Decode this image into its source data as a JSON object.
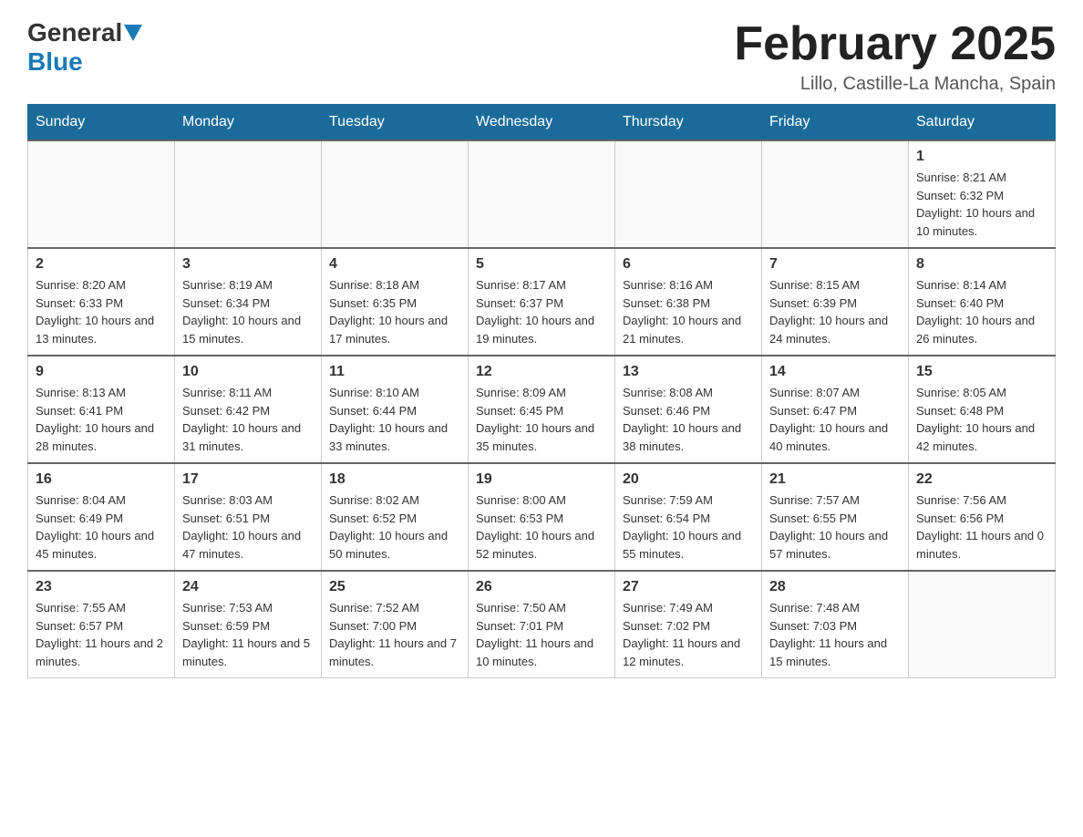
{
  "header": {
    "logo_general": "General",
    "logo_blue": "Blue",
    "month_title": "February 2025",
    "location": "Lillo, Castille-La Mancha, Spain"
  },
  "days_of_week": [
    "Sunday",
    "Monday",
    "Tuesday",
    "Wednesday",
    "Thursday",
    "Friday",
    "Saturday"
  ],
  "weeks": [
    [
      {
        "day": "",
        "info": ""
      },
      {
        "day": "",
        "info": ""
      },
      {
        "day": "",
        "info": ""
      },
      {
        "day": "",
        "info": ""
      },
      {
        "day": "",
        "info": ""
      },
      {
        "day": "",
        "info": ""
      },
      {
        "day": "1",
        "info": "Sunrise: 8:21 AM\nSunset: 6:32 PM\nDaylight: 10 hours and 10 minutes."
      }
    ],
    [
      {
        "day": "2",
        "info": "Sunrise: 8:20 AM\nSunset: 6:33 PM\nDaylight: 10 hours and 13 minutes."
      },
      {
        "day": "3",
        "info": "Sunrise: 8:19 AM\nSunset: 6:34 PM\nDaylight: 10 hours and 15 minutes."
      },
      {
        "day": "4",
        "info": "Sunrise: 8:18 AM\nSunset: 6:35 PM\nDaylight: 10 hours and 17 minutes."
      },
      {
        "day": "5",
        "info": "Sunrise: 8:17 AM\nSunset: 6:37 PM\nDaylight: 10 hours and 19 minutes."
      },
      {
        "day": "6",
        "info": "Sunrise: 8:16 AM\nSunset: 6:38 PM\nDaylight: 10 hours and 21 minutes."
      },
      {
        "day": "7",
        "info": "Sunrise: 8:15 AM\nSunset: 6:39 PM\nDaylight: 10 hours and 24 minutes."
      },
      {
        "day": "8",
        "info": "Sunrise: 8:14 AM\nSunset: 6:40 PM\nDaylight: 10 hours and 26 minutes."
      }
    ],
    [
      {
        "day": "9",
        "info": "Sunrise: 8:13 AM\nSunset: 6:41 PM\nDaylight: 10 hours and 28 minutes."
      },
      {
        "day": "10",
        "info": "Sunrise: 8:11 AM\nSunset: 6:42 PM\nDaylight: 10 hours and 31 minutes."
      },
      {
        "day": "11",
        "info": "Sunrise: 8:10 AM\nSunset: 6:44 PM\nDaylight: 10 hours and 33 minutes."
      },
      {
        "day": "12",
        "info": "Sunrise: 8:09 AM\nSunset: 6:45 PM\nDaylight: 10 hours and 35 minutes."
      },
      {
        "day": "13",
        "info": "Sunrise: 8:08 AM\nSunset: 6:46 PM\nDaylight: 10 hours and 38 minutes."
      },
      {
        "day": "14",
        "info": "Sunrise: 8:07 AM\nSunset: 6:47 PM\nDaylight: 10 hours and 40 minutes."
      },
      {
        "day": "15",
        "info": "Sunrise: 8:05 AM\nSunset: 6:48 PM\nDaylight: 10 hours and 42 minutes."
      }
    ],
    [
      {
        "day": "16",
        "info": "Sunrise: 8:04 AM\nSunset: 6:49 PM\nDaylight: 10 hours and 45 minutes."
      },
      {
        "day": "17",
        "info": "Sunrise: 8:03 AM\nSunset: 6:51 PM\nDaylight: 10 hours and 47 minutes."
      },
      {
        "day": "18",
        "info": "Sunrise: 8:02 AM\nSunset: 6:52 PM\nDaylight: 10 hours and 50 minutes."
      },
      {
        "day": "19",
        "info": "Sunrise: 8:00 AM\nSunset: 6:53 PM\nDaylight: 10 hours and 52 minutes."
      },
      {
        "day": "20",
        "info": "Sunrise: 7:59 AM\nSunset: 6:54 PM\nDaylight: 10 hours and 55 minutes."
      },
      {
        "day": "21",
        "info": "Sunrise: 7:57 AM\nSunset: 6:55 PM\nDaylight: 10 hours and 57 minutes."
      },
      {
        "day": "22",
        "info": "Sunrise: 7:56 AM\nSunset: 6:56 PM\nDaylight: 11 hours and 0 minutes."
      }
    ],
    [
      {
        "day": "23",
        "info": "Sunrise: 7:55 AM\nSunset: 6:57 PM\nDaylight: 11 hours and 2 minutes."
      },
      {
        "day": "24",
        "info": "Sunrise: 7:53 AM\nSunset: 6:59 PM\nDaylight: 11 hours and 5 minutes."
      },
      {
        "day": "25",
        "info": "Sunrise: 7:52 AM\nSunset: 7:00 PM\nDaylight: 11 hours and 7 minutes."
      },
      {
        "day": "26",
        "info": "Sunrise: 7:50 AM\nSunset: 7:01 PM\nDaylight: 11 hours and 10 minutes."
      },
      {
        "day": "27",
        "info": "Sunrise: 7:49 AM\nSunset: 7:02 PM\nDaylight: 11 hours and 12 minutes."
      },
      {
        "day": "28",
        "info": "Sunrise: 7:48 AM\nSunset: 7:03 PM\nDaylight: 11 hours and 15 minutes."
      },
      {
        "day": "",
        "info": ""
      }
    ]
  ]
}
